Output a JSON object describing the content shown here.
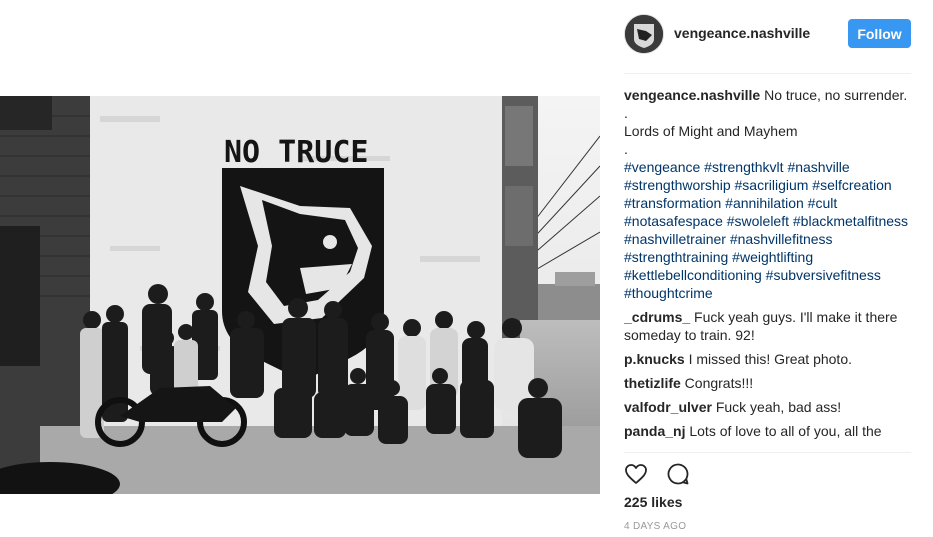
{
  "post": {
    "username": "vengeance.nashville",
    "follow_label": "Follow",
    "photo": {
      "mural_text": "NO TRUCE"
    },
    "caption": {
      "username": "vengeance.nashville",
      "lines": [
        "No truce, no surrender.",
        ".",
        "Lords of Might and Mayhem",
        "."
      ],
      "hashtags": "#vengeance #strengthkvlt #nashville #strengthworship #sacriligium #selfcreation #transformation #annihilation #cult #notasafespace #swoleleft #blackmetalfitness #nashvilletrainer #nashvillefitness #strengthtraining #weightlifting #kettlebellconditioning #subversivefitness #thoughtcrime"
    },
    "comments": [
      {
        "user": "_cdrums_",
        "text": "Fuck yeah guys. I'll make it there someday to train. 92!"
      },
      {
        "user": "p.knucks",
        "text": "I missed this! Great photo."
      },
      {
        "user": "thetizlife",
        "text": "Congrats!!!"
      },
      {
        "user": "valfodr_ulver",
        "text": "Fuck yeah, bad ass!"
      },
      {
        "user": "panda_nj",
        "text": "Lots of love to all of you, all the"
      }
    ],
    "likes_text": "225 likes",
    "time_ago": "4 DAYS AGO",
    "icons": {
      "like": "heart-outline-icon",
      "comment": "speech-bubble-icon"
    },
    "colors": {
      "follow_button": "#3897f0",
      "hashtag": "#003569",
      "meta_gray": "#999999"
    }
  }
}
